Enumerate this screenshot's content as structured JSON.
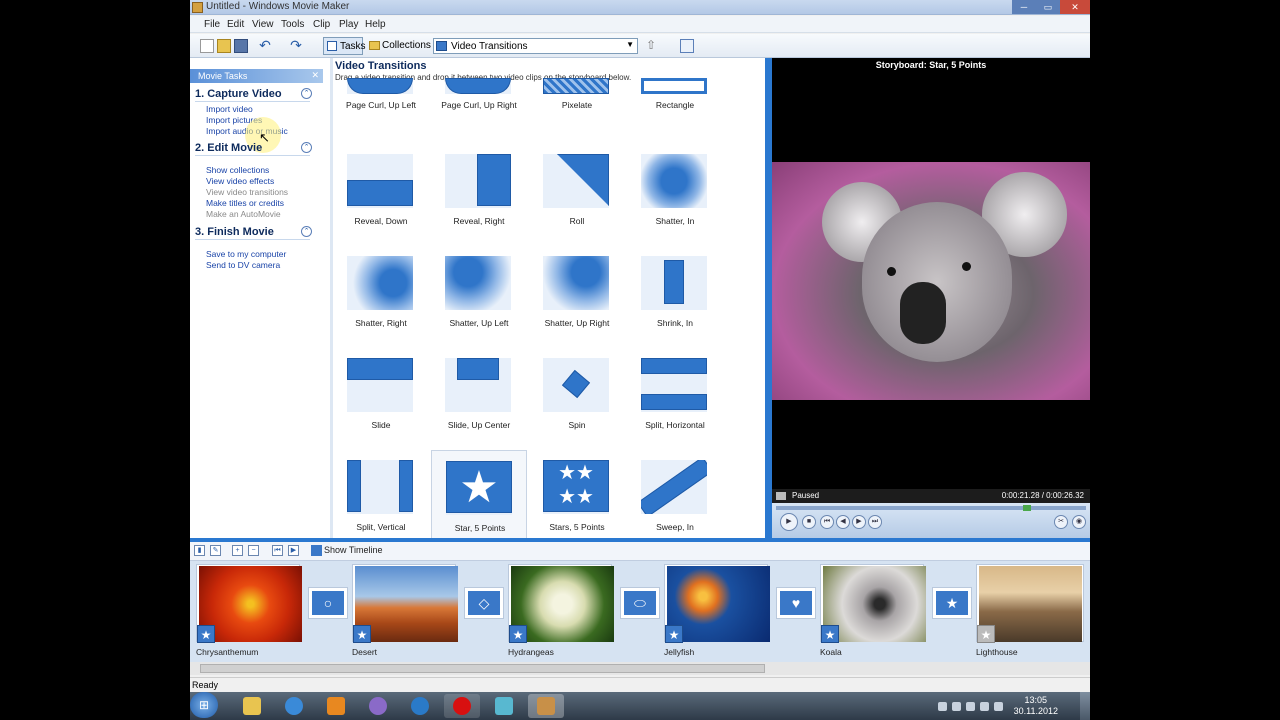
{
  "window": {
    "title": "Untitled - Windows Movie Maker",
    "min": "─",
    "max": "▭",
    "close": "✕"
  },
  "menu": [
    "File",
    "Edit",
    "View",
    "Tools",
    "Clip",
    "Play",
    "Help"
  ],
  "toolbar": {
    "tasks": "Tasks",
    "collections": "Collections",
    "dropdown_value": "Video Transitions"
  },
  "tasks_pane": {
    "header": "Movie Tasks",
    "sections": [
      {
        "title": "1. Capture Video",
        "links": [
          {
            "label": "Import video",
            "enabled": true
          },
          {
            "label": "Import pictures",
            "enabled": true
          },
          {
            "label": "Import audio or music",
            "enabled": true
          }
        ]
      },
      {
        "title": "2. Edit Movie",
        "links": [
          {
            "label": "Show collections",
            "enabled": true
          },
          {
            "label": "View video effects",
            "enabled": true
          },
          {
            "label": "View video transitions",
            "enabled": false
          },
          {
            "label": "Make titles or credits",
            "enabled": true
          },
          {
            "label": "Make an AutoMovie",
            "enabled": false
          }
        ]
      },
      {
        "title": "3. Finish Movie",
        "links": [
          {
            "label": "Save to my computer",
            "enabled": true
          },
          {
            "label": "Send to DV camera",
            "enabled": true
          }
        ]
      }
    ]
  },
  "content": {
    "title": "Video Transitions",
    "subtitle": "Drag a video transition and drop it between two video clips on the storyboard below.",
    "transitions": [
      "Page Curl, Up Left",
      "Page Curl, Up Right",
      "Pixelate",
      "Rectangle",
      "Reveal, Down",
      "Reveal, Right",
      "Roll",
      "Shatter, In",
      "Shatter, Right",
      "Shatter, Up Left",
      "Shatter, Up Right",
      "Shrink, In",
      "Slide",
      "Slide, Up Center",
      "Spin",
      "Split, Horizontal",
      "Split, Vertical",
      "Star, 5 Points",
      "Stars, 5 Points",
      "Sweep, In"
    ],
    "selected": "Star, 5 Points"
  },
  "preview": {
    "title": "Storyboard: Star, 5 Points",
    "state": "Paused",
    "time": "0:00:21.28 / 0:00:26.32",
    "seek_fraction": 0.81
  },
  "storyboard": {
    "show_timeline": "Show Timeline",
    "clips": [
      "Chrysanthemum",
      "Desert",
      "Hydrangeas",
      "Jellyfish",
      "Koala",
      "Lighthouse"
    ],
    "transition_glyphs": [
      "○",
      "◇",
      "⬭",
      "♥",
      "★"
    ]
  },
  "status": "Ready",
  "taskbar": {
    "time": "13:05",
    "date": "30.11.2012"
  },
  "colors": {
    "accent": "#2a78d0",
    "tile_blue": "#2f75c9",
    "link": "#1a44a8"
  }
}
